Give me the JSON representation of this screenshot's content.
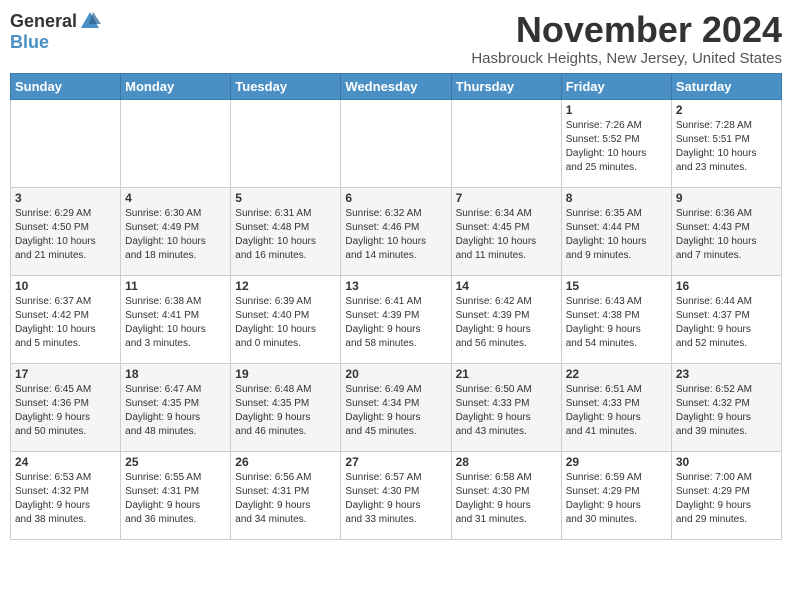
{
  "header": {
    "logo_general": "General",
    "logo_blue": "Blue",
    "month": "November 2024",
    "location": "Hasbrouck Heights, New Jersey, United States"
  },
  "weekdays": [
    "Sunday",
    "Monday",
    "Tuesday",
    "Wednesday",
    "Thursday",
    "Friday",
    "Saturday"
  ],
  "rows": [
    {
      "shade": "white",
      "days": [
        {
          "num": "",
          "info": ""
        },
        {
          "num": "",
          "info": ""
        },
        {
          "num": "",
          "info": ""
        },
        {
          "num": "",
          "info": ""
        },
        {
          "num": "",
          "info": ""
        },
        {
          "num": "1",
          "info": "Sunrise: 7:26 AM\nSunset: 5:52 PM\nDaylight: 10 hours\nand 25 minutes."
        },
        {
          "num": "2",
          "info": "Sunrise: 7:28 AM\nSunset: 5:51 PM\nDaylight: 10 hours\nand 23 minutes."
        }
      ]
    },
    {
      "shade": "gray",
      "days": [
        {
          "num": "3",
          "info": "Sunrise: 6:29 AM\nSunset: 4:50 PM\nDaylight: 10 hours\nand 21 minutes."
        },
        {
          "num": "4",
          "info": "Sunrise: 6:30 AM\nSunset: 4:49 PM\nDaylight: 10 hours\nand 18 minutes."
        },
        {
          "num": "5",
          "info": "Sunrise: 6:31 AM\nSunset: 4:48 PM\nDaylight: 10 hours\nand 16 minutes."
        },
        {
          "num": "6",
          "info": "Sunrise: 6:32 AM\nSunset: 4:46 PM\nDaylight: 10 hours\nand 14 minutes."
        },
        {
          "num": "7",
          "info": "Sunrise: 6:34 AM\nSunset: 4:45 PM\nDaylight: 10 hours\nand 11 minutes."
        },
        {
          "num": "8",
          "info": "Sunrise: 6:35 AM\nSunset: 4:44 PM\nDaylight: 10 hours\nand 9 minutes."
        },
        {
          "num": "9",
          "info": "Sunrise: 6:36 AM\nSunset: 4:43 PM\nDaylight: 10 hours\nand 7 minutes."
        }
      ]
    },
    {
      "shade": "white",
      "days": [
        {
          "num": "10",
          "info": "Sunrise: 6:37 AM\nSunset: 4:42 PM\nDaylight: 10 hours\nand 5 minutes."
        },
        {
          "num": "11",
          "info": "Sunrise: 6:38 AM\nSunset: 4:41 PM\nDaylight: 10 hours\nand 3 minutes."
        },
        {
          "num": "12",
          "info": "Sunrise: 6:39 AM\nSunset: 4:40 PM\nDaylight: 10 hours\nand 0 minutes."
        },
        {
          "num": "13",
          "info": "Sunrise: 6:41 AM\nSunset: 4:39 PM\nDaylight: 9 hours\nand 58 minutes."
        },
        {
          "num": "14",
          "info": "Sunrise: 6:42 AM\nSunset: 4:39 PM\nDaylight: 9 hours\nand 56 minutes."
        },
        {
          "num": "15",
          "info": "Sunrise: 6:43 AM\nSunset: 4:38 PM\nDaylight: 9 hours\nand 54 minutes."
        },
        {
          "num": "16",
          "info": "Sunrise: 6:44 AM\nSunset: 4:37 PM\nDaylight: 9 hours\nand 52 minutes."
        }
      ]
    },
    {
      "shade": "gray",
      "days": [
        {
          "num": "17",
          "info": "Sunrise: 6:45 AM\nSunset: 4:36 PM\nDaylight: 9 hours\nand 50 minutes."
        },
        {
          "num": "18",
          "info": "Sunrise: 6:47 AM\nSunset: 4:35 PM\nDaylight: 9 hours\nand 48 minutes."
        },
        {
          "num": "19",
          "info": "Sunrise: 6:48 AM\nSunset: 4:35 PM\nDaylight: 9 hours\nand 46 minutes."
        },
        {
          "num": "20",
          "info": "Sunrise: 6:49 AM\nSunset: 4:34 PM\nDaylight: 9 hours\nand 45 minutes."
        },
        {
          "num": "21",
          "info": "Sunrise: 6:50 AM\nSunset: 4:33 PM\nDaylight: 9 hours\nand 43 minutes."
        },
        {
          "num": "22",
          "info": "Sunrise: 6:51 AM\nSunset: 4:33 PM\nDaylight: 9 hours\nand 41 minutes."
        },
        {
          "num": "23",
          "info": "Sunrise: 6:52 AM\nSunset: 4:32 PM\nDaylight: 9 hours\nand 39 minutes."
        }
      ]
    },
    {
      "shade": "white",
      "days": [
        {
          "num": "24",
          "info": "Sunrise: 6:53 AM\nSunset: 4:32 PM\nDaylight: 9 hours\nand 38 minutes."
        },
        {
          "num": "25",
          "info": "Sunrise: 6:55 AM\nSunset: 4:31 PM\nDaylight: 9 hours\nand 36 minutes."
        },
        {
          "num": "26",
          "info": "Sunrise: 6:56 AM\nSunset: 4:31 PM\nDaylight: 9 hours\nand 34 minutes."
        },
        {
          "num": "27",
          "info": "Sunrise: 6:57 AM\nSunset: 4:30 PM\nDaylight: 9 hours\nand 33 minutes."
        },
        {
          "num": "28",
          "info": "Sunrise: 6:58 AM\nSunset: 4:30 PM\nDaylight: 9 hours\nand 31 minutes."
        },
        {
          "num": "29",
          "info": "Sunrise: 6:59 AM\nSunset: 4:29 PM\nDaylight: 9 hours\nand 30 minutes."
        },
        {
          "num": "30",
          "info": "Sunrise: 7:00 AM\nSunset: 4:29 PM\nDaylight: 9 hours\nand 29 minutes."
        }
      ]
    }
  ]
}
